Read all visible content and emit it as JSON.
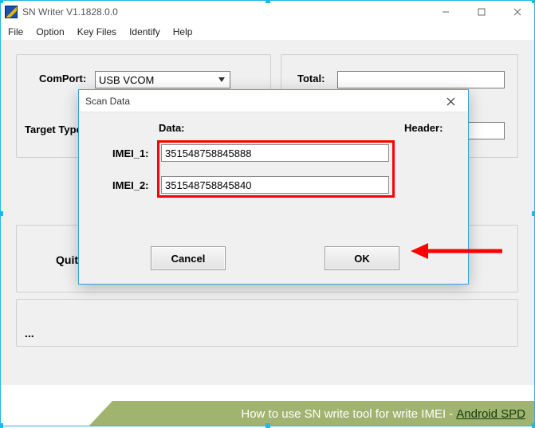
{
  "window": {
    "title": "SN Writer V1.1828.0.0"
  },
  "menu": {
    "file": "File",
    "option": "Option",
    "keyfiles": "Key Files",
    "identify": "Identify",
    "help": "Help"
  },
  "main": {
    "comport_label": "ComPort:",
    "comport_value": "USB VCOM",
    "target_type_label": "Target Type:",
    "total_label": "Total:",
    "quit_label": "Quit",
    "status_text": "..."
  },
  "dialog": {
    "title": "Scan Data",
    "data_header": "Data:",
    "header_header": "Header:",
    "imei1_label": "IMEI_1:",
    "imei1_value": "351548758845888",
    "imei2_label": "IMEI_2:",
    "imei2_value": "351548758845840",
    "cancel": "Cancel",
    "ok": "OK"
  },
  "footer": {
    "text": "How to use SN write tool for write IMEI - ",
    "link": "Android SPD"
  }
}
